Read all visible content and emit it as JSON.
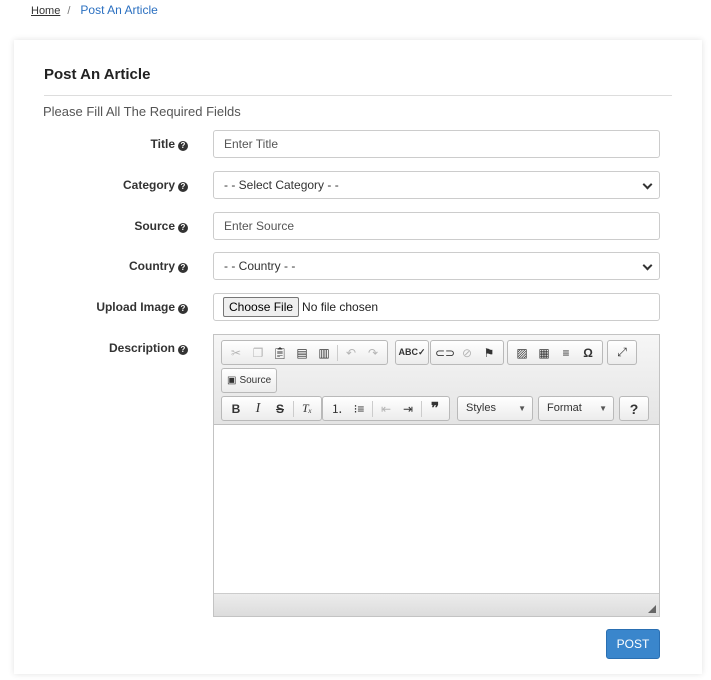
{
  "breadcrumb": {
    "home": "Home",
    "separator": "/",
    "current": "Post An Article"
  },
  "card": {
    "title": "Post An Article",
    "subtitle": "Please Fill All The Required Fields"
  },
  "form": {
    "title_label": "Title",
    "title_placeholder": "Enter Title",
    "category_label": "Category",
    "category_value": "- - Select Category - -",
    "source_label": "Source",
    "source_placeholder": "Enter Source",
    "country_label": "Country",
    "country_value": "- - Country - -",
    "image_label": "Upload Image",
    "file_button": "Choose File",
    "file_status": "No file chosen",
    "description_label": "Description"
  },
  "editor": {
    "source_label": "Source",
    "styles_label": "Styles",
    "format_label": "Format",
    "help_label": "?"
  },
  "submit_label": "POST",
  "colors": {
    "accent": "#3a86cc",
    "link": "#2a6fc0"
  }
}
